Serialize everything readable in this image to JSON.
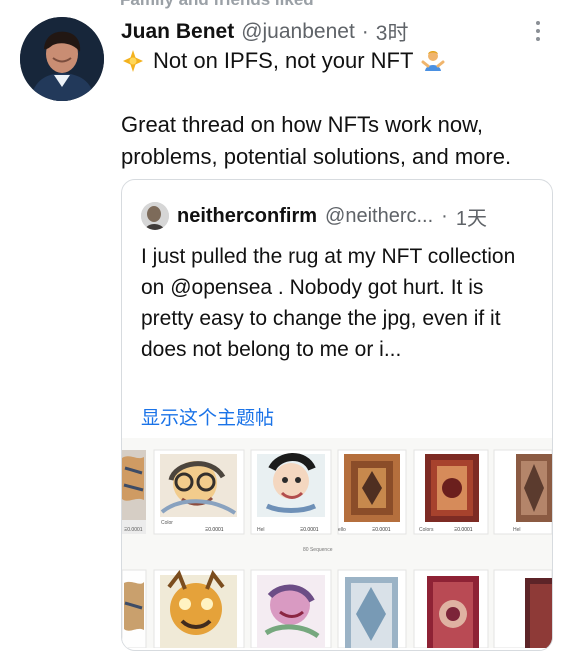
{
  "top_partial_text": "Family and friends liked",
  "tweet": {
    "author_name": "Juan Benet",
    "author_handle": "@juanbenet",
    "separator": "·",
    "time": "3时",
    "line1_text": "Not on IPFS, not your NFT",
    "body": "Great thread on how NFTs work now, problems, potential solutions, and more.",
    "more_icon": "more-vertical-icon"
  },
  "quoted_tweet": {
    "author_name": "neitherconfirm",
    "author_handle": "@neitherc...",
    "separator": "·",
    "time": "1天",
    "body": "I just pulled the rug at my NFT collection on @opensea . Nobody got hurt. It is pretty easy to change the jpg, even if it does not belong to me or i...",
    "show_thread_label": "显示这个主题帖"
  },
  "nft_preview": {
    "row1_cards": [
      {
        "name": "",
        "price": "Ξ0.0001"
      },
      {
        "name": "Color",
        "price": "Ξ0.0001"
      },
      {
        "name": "Hel",
        "price": "Ξ0.0001"
      },
      {
        "name": "ello",
        "price": "Ξ0.0001"
      },
      {
        "name": "Colors",
        "price": "Ξ0.0001"
      },
      {
        "name": "Hel",
        "price": ""
      }
    ],
    "row1_footer": "80 Sequence"
  }
}
